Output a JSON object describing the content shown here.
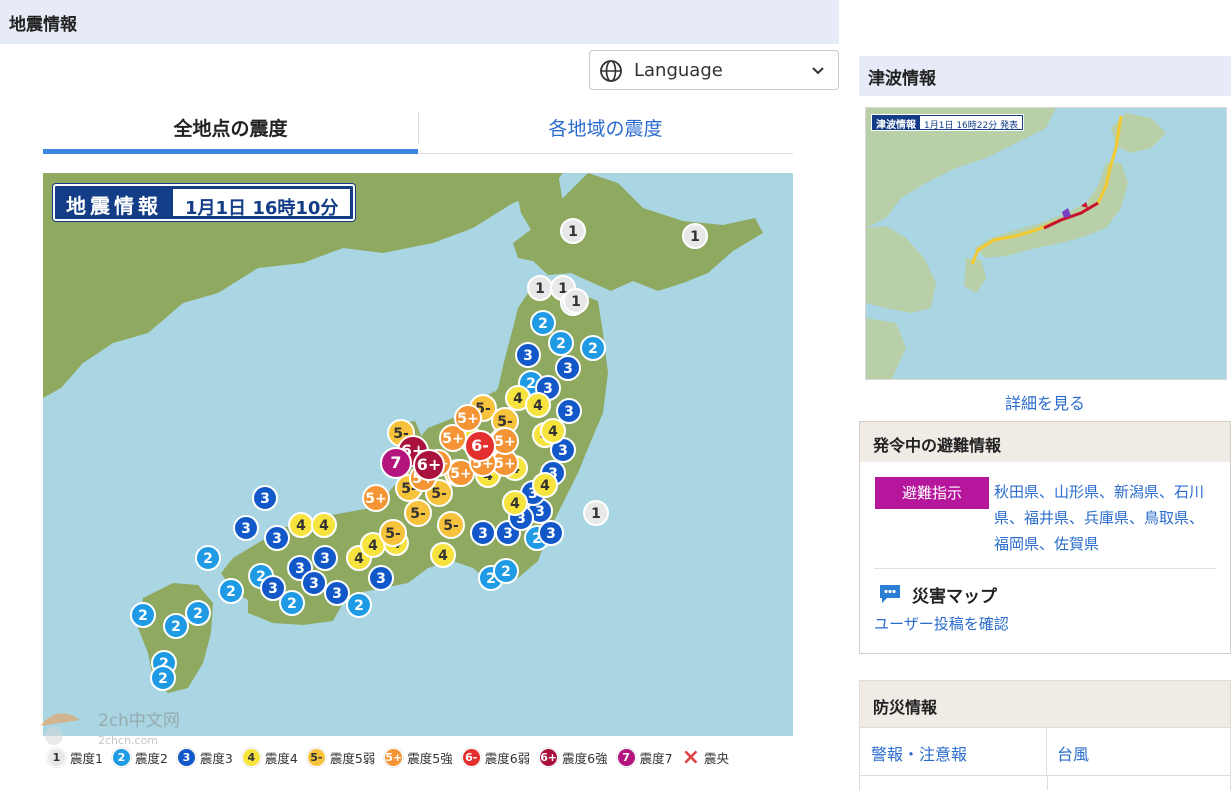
{
  "header": {
    "title": "地震情報"
  },
  "language": {
    "label": "Language"
  },
  "tabs": [
    {
      "label": "全地点の震度",
      "active": true
    },
    {
      "label": "各地域の震度",
      "active": false
    }
  ],
  "quake_map": {
    "badge_title": "地震情報",
    "badge_datetime": "1月1日 16時10分",
    "markers": [
      {
        "label": "1",
        "intensity": "1"
      },
      {
        "label": "2",
        "intensity": "2"
      },
      {
        "label": "3",
        "intensity": "3"
      },
      {
        "label": "4",
        "intensity": "4"
      },
      {
        "label": "5-",
        "intensity": "5-"
      },
      {
        "label": "5+",
        "intensity": "5+"
      },
      {
        "label": "6-",
        "intensity": "6-"
      },
      {
        "label": "6+",
        "intensity": "6+"
      },
      {
        "label": "7",
        "intensity": "7"
      }
    ]
  },
  "legend": [
    {
      "label": "震度1",
      "level": "1",
      "color": "#e8e8e8",
      "text_color": "#333333"
    },
    {
      "label": "震度2",
      "level": "2",
      "color": "#1f9be6",
      "text_color": "#ffffff"
    },
    {
      "label": "震度3",
      "level": "3",
      "color": "#1358c8",
      "text_color": "#ffffff"
    },
    {
      "label": "震度4",
      "level": "4",
      "color": "#f6e33d",
      "text_color": "#333333"
    },
    {
      "label": "震度5弱",
      "level": "5-",
      "color": "#f7c23c",
      "text_color": "#333333"
    },
    {
      "label": "震度5強",
      "level": "5+",
      "color": "#f49434",
      "text_color": "#ffffff"
    },
    {
      "label": "震度6弱",
      "level": "6-",
      "color": "#e42f2f",
      "text_color": "#ffffff"
    },
    {
      "label": "震度6強",
      "level": "6+",
      "color": "#a9123c",
      "text_color": "#ffffff"
    },
    {
      "label": "震度7",
      "level": "7",
      "color": "#b3147e",
      "text_color": "#ffffff"
    },
    {
      "label": "震央",
      "level": "×",
      "color": "#e04545",
      "text_color": "#e04545"
    }
  ],
  "watermark": {
    "line1": "2ch中文网",
    "line2": "2chcn.com"
  },
  "tsunami": {
    "title": "津波情報",
    "badge_title": "津波情報",
    "badge_datetime": "1月1日 16時22分 発表",
    "detail_link": "詳細を見る"
  },
  "evacuation": {
    "title": "発令中の避難情報",
    "tag": "避難指示",
    "prefectures": "秋田県、山形県、新潟県、石川県、福井県、兵庫県、鳥取県、福岡県、佐賀県",
    "disaster_map_title": "災害マップ",
    "disaster_map_link": "ユーザー投稿を確認"
  },
  "bosai": {
    "title": "防災情報",
    "links": [
      "警報・注意報",
      "台風"
    ]
  },
  "colors": {
    "accent_blue": "#2a6ccd",
    "tab_active": "#3d86e0",
    "badge_navy": "#133d87",
    "evac_magenta": "#b5169c",
    "sea": "#a9d6e2",
    "land": "#8fa960"
  }
}
